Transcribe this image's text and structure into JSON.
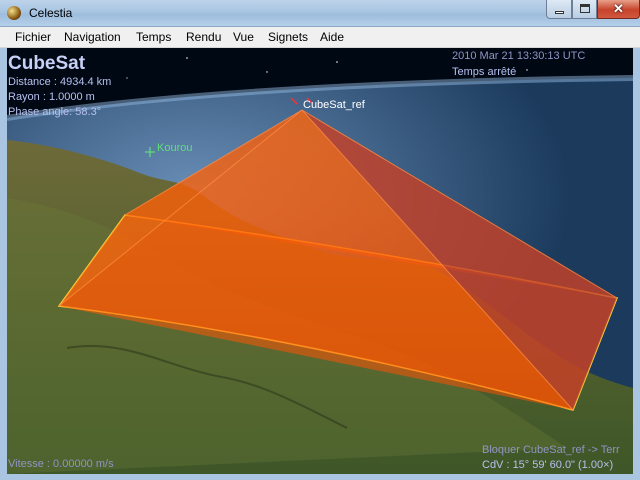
{
  "window": {
    "title": "Celestia"
  },
  "menu": {
    "items": [
      "Fichier",
      "Navigation",
      "Temps",
      "Rendu",
      "Vue",
      "Signets",
      "Aide"
    ]
  },
  "hud": {
    "object_name": "CubeSat",
    "distance": "Distance : 4934.4 km",
    "radius": "Rayon : 1.0000 m",
    "phase_angle": "Phase angle: 58.3°",
    "datetime": "2010 Mar 21 13:30:13 UTC",
    "time_status": "Temps arrêté",
    "speed": "Vitesse : 0.00000 m/s",
    "lock_status": "Bloquer CubeSat_ref -> Terr",
    "fov": "CdV : 15° 59' 60.0\" (1.00×)"
  },
  "scene": {
    "satellite_label": "CubeSat_ref",
    "site_label": "Kourou",
    "colors": {
      "sky": "#000814",
      "ocean": "#1d3f63",
      "land": "#4a5a2a",
      "footprint": "#ff5a00",
      "footprint_edge": "#ffd23a",
      "hud_text": "#b6c0ee",
      "site_marker": "#5fe07a"
    }
  }
}
